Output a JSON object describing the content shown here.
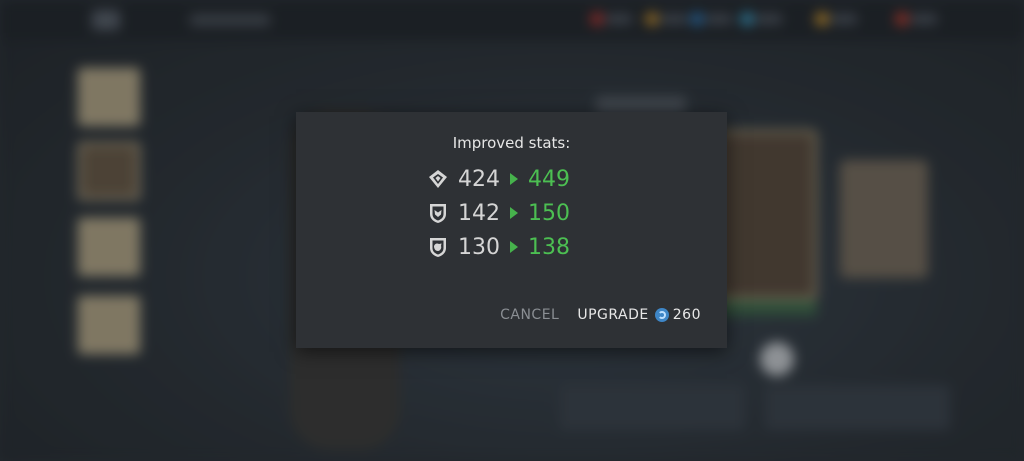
{
  "dialog": {
    "title": "Improved stats:",
    "stats": [
      {
        "icon": "attack-icon",
        "old": "424",
        "new": "449"
      },
      {
        "icon": "defense-shield-icon",
        "old": "142",
        "new": "150"
      },
      {
        "icon": "health-shield-icon",
        "old": "130",
        "new": "138"
      }
    ],
    "cancel_label": "CANCEL",
    "upgrade_label": "UPGRADE",
    "upgrade_cost": "260",
    "cost_icon": "currency-coin-icon"
  },
  "colors": {
    "dialog_bg": "#2e3135",
    "new_value": "#4cbf52",
    "arrow": "#46b24c",
    "old_value": "#d5d5d5",
    "cancel": "#8a8e93"
  }
}
